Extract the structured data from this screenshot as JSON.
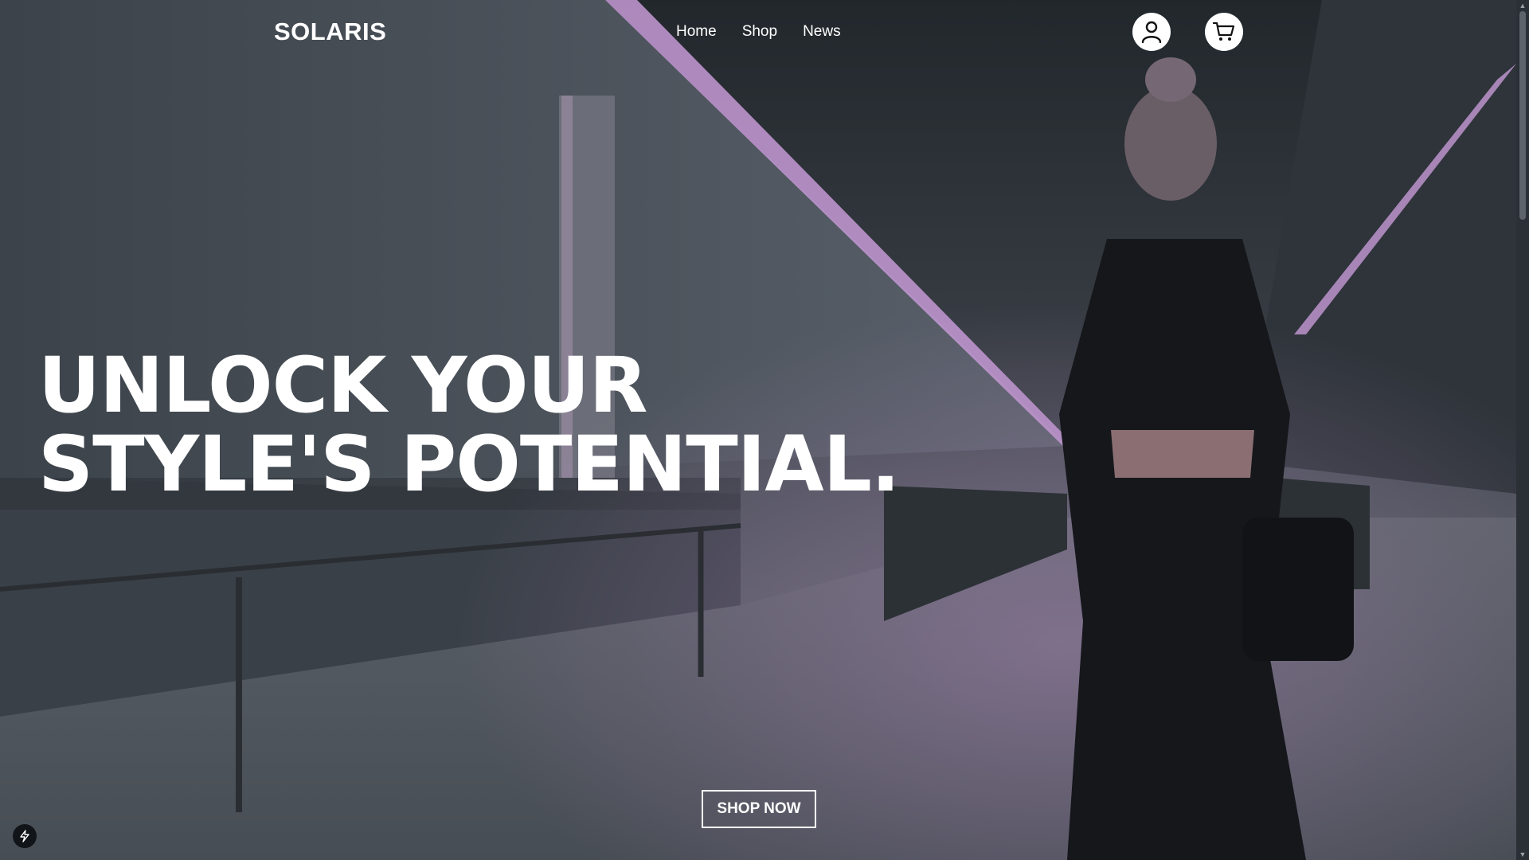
{
  "header": {
    "logo": "SOLARIS",
    "nav": [
      "Home",
      "Shop",
      "News"
    ],
    "user_icon": "user-icon",
    "cart_icon": "cart-icon"
  },
  "hero": {
    "headline_line1": "UNLOCK YOUR",
    "headline_line2": "STYLE'S POTENTIAL.",
    "cta_label": "SHOP NOW",
    "background": "photo of woman in black techwear standing in a moving-walkway tunnel with pink ceiling lights"
  },
  "colors": {
    "text": "#ffffff",
    "accent_light": "#c59ad6"
  }
}
